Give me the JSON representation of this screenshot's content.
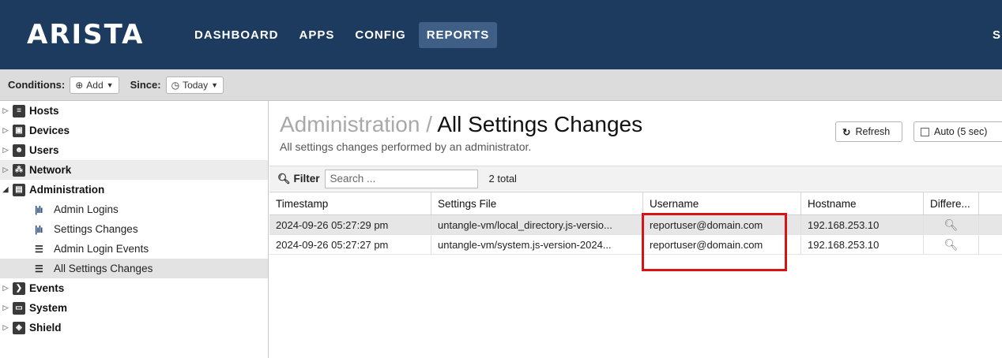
{
  "header": {
    "logo": "ARISTA",
    "nav": [
      "DASHBOARD",
      "APPS",
      "CONFIG",
      "REPORTS"
    ],
    "active_nav": "REPORTS",
    "user_initial": "S"
  },
  "conditions": {
    "conditions_label": "Conditions:",
    "add_label": "Add",
    "since_label": "Since:",
    "since_value": "Today"
  },
  "sidebar": {
    "items": [
      {
        "label": "Hosts",
        "icon": "list-icon"
      },
      {
        "label": "Devices",
        "icon": "devices-icon"
      },
      {
        "label": "Users",
        "icon": "users-icon"
      },
      {
        "label": "Network",
        "icon": "network-icon"
      },
      {
        "label": "Administration",
        "icon": "admin-icon"
      },
      {
        "label": "Admin Logins",
        "icon": "bar-chart-icon"
      },
      {
        "label": "Settings Changes",
        "icon": "bar-chart-icon"
      },
      {
        "label": "Admin Login Events",
        "icon": "list-lines-icon"
      },
      {
        "label": "All Settings Changes",
        "icon": "list-lines-icon"
      },
      {
        "label": "Events",
        "icon": "events-icon"
      },
      {
        "label": "System",
        "icon": "system-icon"
      },
      {
        "label": "Shield",
        "icon": "shield-icon"
      }
    ]
  },
  "main": {
    "crumb": "Administration / ",
    "title": "All Settings Changes",
    "subtitle": "All settings changes performed by an administrator.",
    "refresh_label": "Refresh",
    "auto_label": "Auto (5 sec)",
    "filter_label": "Filter",
    "search_placeholder": "Search ...",
    "total": "2 total"
  },
  "table": {
    "columns": [
      "Timestamp",
      "Settings File",
      "Username",
      "Hostname",
      "Differe..."
    ],
    "rows": [
      [
        "2024-09-26 05:27:29 pm",
        "untangle-vm/local_directory.js-versio...",
        "reportuser@domain.com",
        "192.168.253.10"
      ],
      [
        "2024-09-26 05:27:27 pm",
        "untangle-vm/system.js-version-2024...",
        "reportuser@domain.com",
        "192.168.253.10"
      ]
    ]
  },
  "colors": {
    "topbar": "#1d3a5f",
    "active_nav": "#3f5f87",
    "highlight": "#d51414"
  }
}
